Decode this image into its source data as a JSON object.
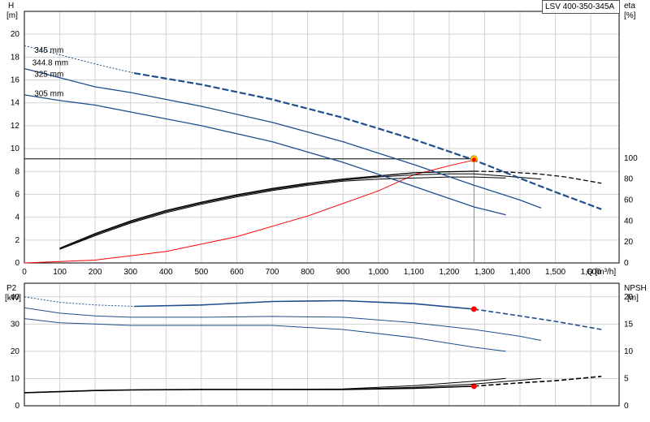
{
  "model_label": "LSV 400-350-345A",
  "colors": {
    "curve": "#1f4e8c",
    "black": "#000000",
    "system": "#ff0000",
    "grid": "#d3d3d3",
    "dot_fill": "#ffcc00"
  },
  "chart_data": [
    {
      "type": "line",
      "name": "H-Q / efficiency",
      "left_axis": {
        "label_line1": "H",
        "label_line2": "[m]",
        "ylim": [
          0,
          22
        ],
        "ticks": [
          0,
          2,
          4,
          6,
          8,
          10,
          12,
          14,
          16,
          18,
          20
        ]
      },
      "right_axis": {
        "label_line1": "eta",
        "label_line2": "[%]",
        "ylim": [
          0,
          240
        ],
        "ticks": [
          0,
          20,
          40,
          60,
          80,
          100
        ]
      },
      "x_axis": {
        "label": "Q [m³/h]",
        "xlim": [
          0,
          1680
        ],
        "ticks": [
          0,
          100,
          200,
          300,
          400,
          500,
          600,
          700,
          800,
          900,
          1000,
          1100,
          1200,
          1300,
          1400,
          1500,
          1600
        ],
        "tick_labels": [
          "0",
          "100",
          "200",
          "300",
          "400",
          "500",
          "600",
          "700",
          "800",
          "900",
          "1,000",
          "1,100",
          "1,200",
          "1,300",
          "1,400",
          "1,500",
          "1,600"
        ]
      },
      "grid": true,
      "head_curves": [
        {
          "name": "345 mm",
          "label_y": 18.6,
          "dashed_end": 310,
          "x": [
            0,
            100,
            200,
            310,
            500,
            700,
            900,
            1100,
            1270,
            1400,
            1500,
            1630
          ],
          "y": [
            19.0,
            18.2,
            17.4,
            16.6,
            15.6,
            14.3,
            12.7,
            10.8,
            9.0,
            7.4,
            6.2,
            4.7
          ]
        },
        {
          "name": "344.8 mm",
          "label_y": 17.5,
          "x": [
            0,
            100,
            200,
            300,
            500,
            700,
            900,
            1100,
            1270,
            1400,
            1460
          ],
          "y": [
            17.0,
            16.2,
            15.4,
            14.9,
            13.7,
            12.3,
            10.6,
            8.6,
            6.8,
            5.5,
            4.8
          ]
        },
        {
          "name": "325 mm",
          "label_y": 16.5,
          "x": [
            0,
            100,
            200,
            300,
            500,
            700,
            900,
            1100,
            1270,
            1360
          ],
          "y": [
            14.7,
            14.2,
            13.8,
            13.2,
            12.0,
            10.6,
            8.8,
            6.7,
            4.9,
            4.2
          ]
        },
        {
          "name": "305 mm",
          "label_y": 14.8
        }
      ],
      "efficiency_curves": [
        {
          "x": [
            100,
            200,
            300,
            400,
            500,
            600,
            700,
            800,
            900,
            1000,
            1100,
            1200,
            1270,
            1350,
            1450,
            1530,
            1630
          ],
          "y": [
            14,
            28,
            40,
            50,
            58,
            65,
            71,
            76,
            80,
            83,
            86,
            87,
            87.5,
            87,
            85,
            82,
            76
          ],
          "dashed_from": 1270
        },
        {
          "x": [
            100,
            200,
            300,
            400,
            500,
            600,
            700,
            800,
            900,
            1000,
            1100,
            1200,
            1270,
            1350,
            1460
          ],
          "y": [
            13,
            27,
            39,
            49,
            57,
            64,
            70,
            75,
            79,
            82,
            84,
            85,
            85,
            83,
            80
          ]
        },
        {
          "x": [
            100,
            200,
            300,
            400,
            500,
            600,
            700,
            800,
            900,
            1000,
            1100,
            1200,
            1270,
            1360
          ],
          "y": [
            13,
            26,
            38,
            48,
            56,
            63,
            69,
            74,
            78,
            80,
            81,
            82,
            82,
            81
          ]
        }
      ],
      "system_curve": {
        "x": [
          0,
          200,
          400,
          600,
          800,
          1000,
          1100,
          1200,
          1270
        ],
        "y": [
          0,
          0.25,
          1.0,
          2.3,
          4.1,
          6.3,
          7.7,
          8.5,
          9.0
        ]
      },
      "operating_point": {
        "q": 1270,
        "h": 9.1
      },
      "crosshair": {
        "h": 9.1,
        "q": 1270
      }
    },
    {
      "type": "line",
      "name": "P2 / NPSH",
      "left_axis": {
        "label_line1": "P2",
        "label_line2": "[kW]",
        "ylim": [
          0,
          45
        ],
        "ticks": [
          0,
          10,
          20,
          30,
          40
        ]
      },
      "right_axis": {
        "label_line1": "NPSH",
        "label_line2": "[m]",
        "ylim": [
          0,
          22.5
        ],
        "ticks": [
          0,
          5,
          10,
          15,
          20
        ]
      },
      "x_axis": {
        "xlim": [
          0,
          1680
        ]
      },
      "grid": true,
      "power_curves": [
        {
          "x": [
            0,
            100,
            200,
            310,
            500,
            700,
            900,
            1100,
            1270,
            1400,
            1500,
            1630
          ],
          "y": [
            40,
            38,
            37,
            36.5,
            37,
            38.3,
            38.6,
            37.5,
            35.5,
            33,
            31,
            28
          ],
          "dashed_until": 310,
          "dashed_from": 1270,
          "marker_at": 1270
        },
        {
          "x": [
            0,
            100,
            200,
            300,
            500,
            700,
            900,
            1100,
            1270,
            1400,
            1460
          ],
          "y": [
            36,
            34,
            33,
            32.5,
            32.5,
            32.8,
            32.5,
            30.5,
            28,
            25.5,
            24
          ]
        },
        {
          "x": [
            0,
            100,
            200,
            300,
            500,
            700,
            900,
            1100,
            1270,
            1360
          ],
          "y": [
            32,
            30.5,
            30,
            29.5,
            29.5,
            29.5,
            28,
            25,
            21.5,
            20
          ]
        }
      ],
      "npsh_curves": [
        {
          "x": [
            0,
            100,
            200,
            300,
            500,
            700,
            900,
            1100,
            1270,
            1400,
            1500,
            1630
          ],
          "y": [
            2.4,
            2.6,
            2.8,
            2.9,
            3.0,
            3.0,
            3.0,
            3.2,
            3.6,
            4.2,
            4.6,
            5.4
          ],
          "dashed_from": 1270,
          "marker_at": 1270
        },
        {
          "x": [
            0,
            100,
            200,
            300,
            500,
            700,
            900,
            1100,
            1270,
            1460
          ],
          "y": [
            2.4,
            2.6,
            2.8,
            2.9,
            3.0,
            3.0,
            3.0,
            3.4,
            4.0,
            5.0
          ]
        },
        {
          "x": [
            0,
            100,
            200,
            300,
            500,
            700,
            900,
            1100,
            1270,
            1360
          ],
          "y": [
            2.4,
            2.6,
            2.8,
            2.9,
            3.0,
            3.0,
            3.1,
            3.7,
            4.5,
            5.0
          ]
        }
      ]
    }
  ]
}
